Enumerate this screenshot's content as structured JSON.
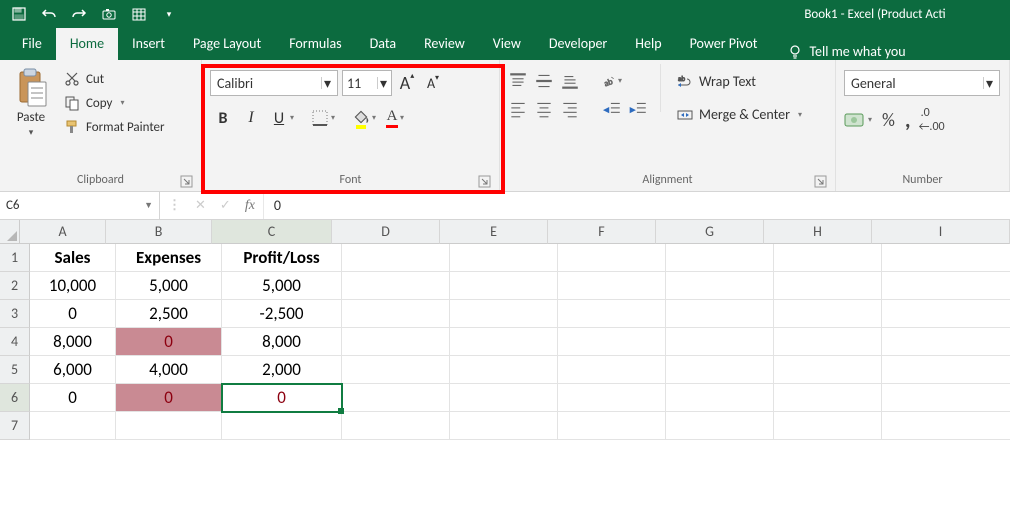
{
  "title": "Book1  -  Excel (Product Acti",
  "tabs": {
    "file": "File",
    "home": "Home",
    "insert": "Insert",
    "page_layout": "Page Layout",
    "formulas": "Formulas",
    "data": "Data",
    "review": "Review",
    "view": "View",
    "developer": "Developer",
    "help": "Help",
    "power_pivot": "Power Pivot",
    "tell_me": "Tell me what you"
  },
  "ribbon": {
    "clipboard": {
      "label": "Clipboard",
      "paste": "Paste",
      "cut": "Cut",
      "copy": "Copy",
      "format_painter": "Format Painter"
    },
    "font": {
      "label": "Font",
      "name": "Calibri",
      "size": "11"
    },
    "alignment": {
      "label": "Alignment",
      "wrap": "Wrap Text",
      "merge": "Merge & Center"
    },
    "number": {
      "label": "Number",
      "format": "General"
    }
  },
  "formula_bar": {
    "name_box": "C6",
    "fx": "fx",
    "value": "0"
  },
  "columns": [
    "A",
    "B",
    "C",
    "D",
    "E",
    "F",
    "G",
    "H",
    "I"
  ],
  "rows": [
    "1",
    "2",
    "3",
    "4",
    "5",
    "6",
    "7"
  ],
  "sheet": {
    "headers": {
      "A": "Sales",
      "B": "Expenses",
      "C": "Profit/Loss"
    },
    "r2": {
      "A": "10,000",
      "B": "5,000",
      "C": "5,000"
    },
    "r3": {
      "A": "0",
      "B": "2,500",
      "C": "-2,500"
    },
    "r4": {
      "A": "8,000",
      "B": "0",
      "C": "8,000"
    },
    "r5": {
      "A": "6,000",
      "B": "4,000",
      "C": "2,000"
    },
    "r6": {
      "A": "0",
      "B": "0",
      "C": "0"
    }
  },
  "selected_cell": "C6",
  "chart_data": {
    "type": "table",
    "columns": [
      "Sales",
      "Expenses",
      "Profit/Loss"
    ],
    "rows": [
      [
        10000,
        5000,
        5000
      ],
      [
        0,
        2500,
        -2500
      ],
      [
        8000,
        0,
        8000
      ],
      [
        6000,
        4000,
        2000
      ],
      [
        0,
        0,
        0
      ]
    ]
  }
}
